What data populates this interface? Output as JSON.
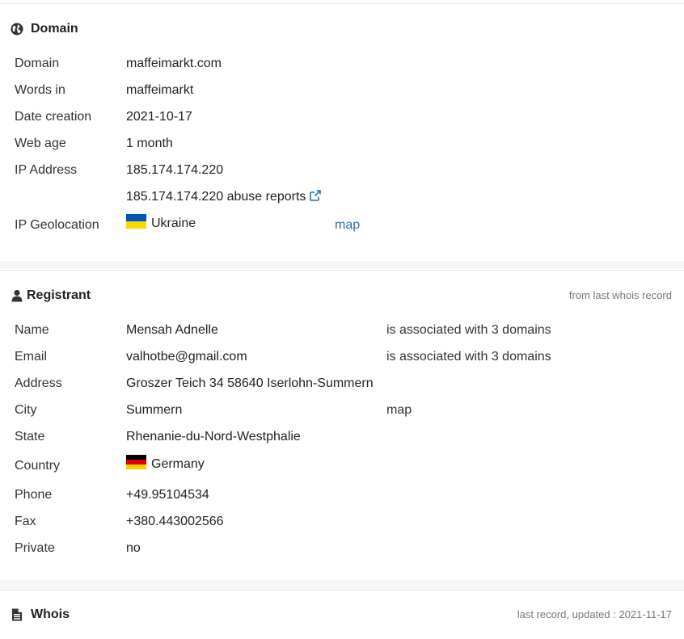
{
  "domain_section": {
    "title": "Domain",
    "icon": "globe-icon",
    "rows": [
      {
        "label": "Domain",
        "value": "maffeimarkt.com"
      },
      {
        "label": "Words in",
        "value": "maffeimarkt"
      },
      {
        "label": "Date creation",
        "value": "2021-10-17"
      },
      {
        "label": "Web age",
        "value": "1 month"
      },
      {
        "label": "IP Address",
        "value": "185.174.174.220"
      }
    ],
    "abuse_link": "185.174.174.220 abuse reports",
    "geolocation": {
      "label": "IP Geolocation",
      "country": "Ukraine",
      "map_label": "map"
    }
  },
  "registrant_section": {
    "title": "Registrant",
    "icon": "user-icon",
    "note": "from last whois record",
    "name": {
      "label": "Name",
      "value": "Mensah Adnelle",
      "extra": "is associated with 3 domains"
    },
    "email": {
      "label": "Email",
      "value": "valhotbe@gmail.com",
      "extra": "is associated with 3 domains"
    },
    "address": {
      "label": "Address",
      "value": "Groszer Teich 34 58640 Iserlohn-Summern"
    },
    "city": {
      "label": "City",
      "value": "Summern",
      "map_label": "map"
    },
    "state": {
      "label": "State",
      "value": "Rhenanie-du-Nord-Westphalie"
    },
    "country": {
      "label": "Country",
      "value": "Germany"
    },
    "phone": {
      "label": "Phone",
      "value": "+49.95104534"
    },
    "fax": {
      "label": "Fax",
      "value": "+380.443002566"
    },
    "private": {
      "label": "Private",
      "value": "no"
    }
  },
  "whois_section": {
    "title": "Whois",
    "icon": "document-icon",
    "note": "last record, updated : 2021-11-17"
  },
  "colors": {
    "link": "#2a6db5",
    "ukraine_flag": [
      "#0057b7",
      "#ffd700"
    ],
    "germany_flag": [
      "#000000",
      "#dd0000",
      "#ffce00"
    ]
  }
}
